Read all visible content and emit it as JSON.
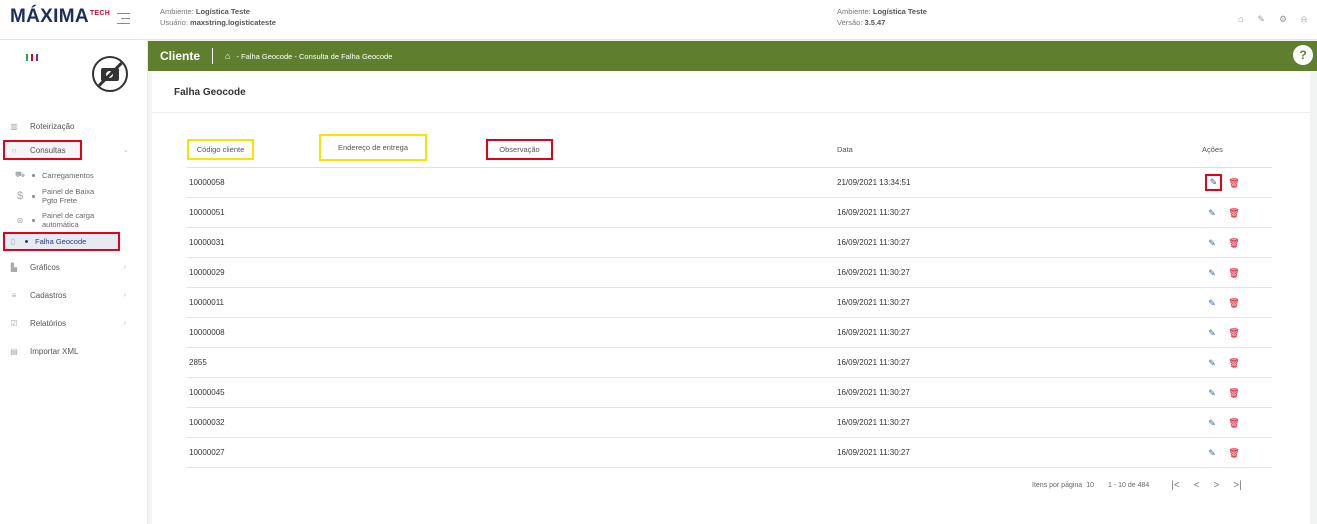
{
  "header": {
    "logo_text": "MÁXIMA",
    "logo_suffix": "TECH",
    "env1_label": "Ambiente:",
    "env1_value": "Logística Teste",
    "user_label": "Usuário:",
    "user_value": "maxstring.logisticateste",
    "env2_label": "Ambiente:",
    "env2_value": "Logística Teste",
    "version_label": "Versão:",
    "version_value": "3.5.47"
  },
  "sidebar": {
    "items": [
      {
        "label": "Roteirização",
        "icon": "map-icon"
      },
      {
        "label": "Consultas",
        "icon": "search-icon"
      },
      {
        "label": "Gráficos",
        "icon": "chart-icon"
      },
      {
        "label": "Cadastros",
        "icon": "list-icon"
      },
      {
        "label": "Relatórios",
        "icon": "report-icon"
      },
      {
        "label": "Importar XML",
        "icon": "file-icon"
      }
    ],
    "subitems": [
      {
        "label": "Carregamentos",
        "icon": "truck-icon"
      },
      {
        "label": "Painel de Baixa Pgto Frete",
        "icon": "dollar-icon"
      },
      {
        "label": "Painel de carga automática",
        "icon": "gear-icon"
      },
      {
        "label": "Falha Geocode",
        "icon": "pin-icon"
      }
    ]
  },
  "titlebar": {
    "title": "Cliente",
    "breadcrumb": "- Falha Geocode - Consulta de Falha Geocode",
    "help": "?"
  },
  "page": {
    "title": "Falha Geocode"
  },
  "table": {
    "columns": [
      "Código cliente",
      "Endereço de entrega",
      "Observação",
      "Data",
      "Ações"
    ],
    "rows": [
      {
        "codigo": "10000058",
        "data": "21/09/2021 13:34:51"
      },
      {
        "codigo": "10000051",
        "data": "16/09/2021 11:30:27"
      },
      {
        "codigo": "10000031",
        "data": "16/09/2021 11:30:27"
      },
      {
        "codigo": "10000029",
        "data": "16/09/2021 11:30:27"
      },
      {
        "codigo": "10000011",
        "data": "16/09/2021 11:30:27"
      },
      {
        "codigo": "10000008",
        "data": "16/09/2021 11:30:27"
      },
      {
        "codigo": "2855",
        "data": "16/09/2021 11:30:27"
      },
      {
        "codigo": "10000045",
        "data": "16/09/2021 11:30:27"
      },
      {
        "codigo": "10000032",
        "data": "16/09/2021 11:30:27"
      },
      {
        "codigo": "10000027",
        "data": "16/09/2021 11:30:27"
      }
    ]
  },
  "paginator": {
    "items_per_page_label": "Itens por página",
    "items_per_page": "10",
    "range": "1 - 10 de 484"
  },
  "colors": {
    "accent_green": "#5f7f2f",
    "highlight_red": "#e3001b",
    "highlight_yellow": "#f5e500",
    "delete_red": "#d0021b"
  }
}
